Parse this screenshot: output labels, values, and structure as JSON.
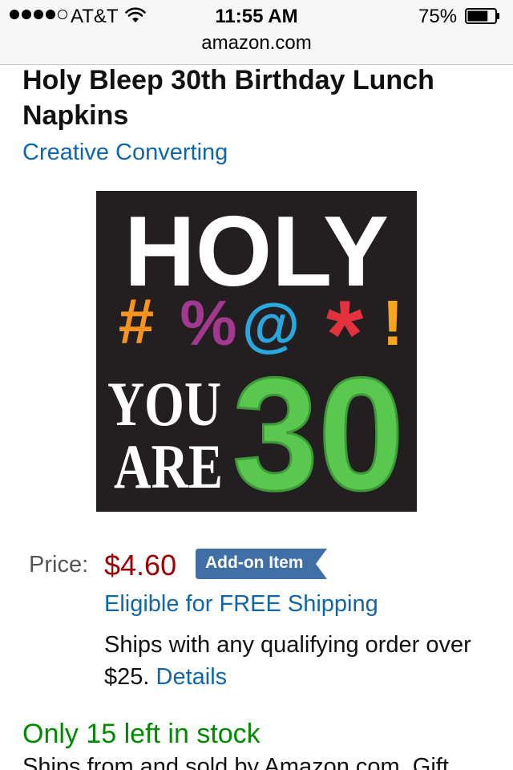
{
  "status_bar": {
    "carrier": "AT&T",
    "time": "11:55 AM",
    "battery_percent": "75%",
    "battery_level": 0.75,
    "signal_bars_filled": 4,
    "signal_bars_total": 5
  },
  "browser": {
    "url": "amazon.com"
  },
  "product": {
    "title": "Holy Bleep 30th Birthday Lunch Napkins",
    "brand": "Creative Converting",
    "image": {
      "line1": "HOLY",
      "symbols": [
        "#",
        "%",
        "@",
        "*",
        "!"
      ],
      "line3": "YOU",
      "line4": "ARE",
      "number": "30"
    }
  },
  "pricing": {
    "label": "Price:",
    "value": "$4.60",
    "badge": "Add-on Item"
  },
  "shipping": {
    "free_shipping": "Eligible for FREE Shipping",
    "qualifying_text": "Ships with any qualifying order over $25.",
    "details_link": "Details"
  },
  "availability": {
    "stock": "Only 15 left in stock",
    "ships_from": "Ships from and sold by Amazon.com. Gift"
  },
  "colors": {
    "link": "#0f66a8",
    "price": "#990000",
    "stock": "#008a00",
    "badge": "#3f6fa5"
  }
}
